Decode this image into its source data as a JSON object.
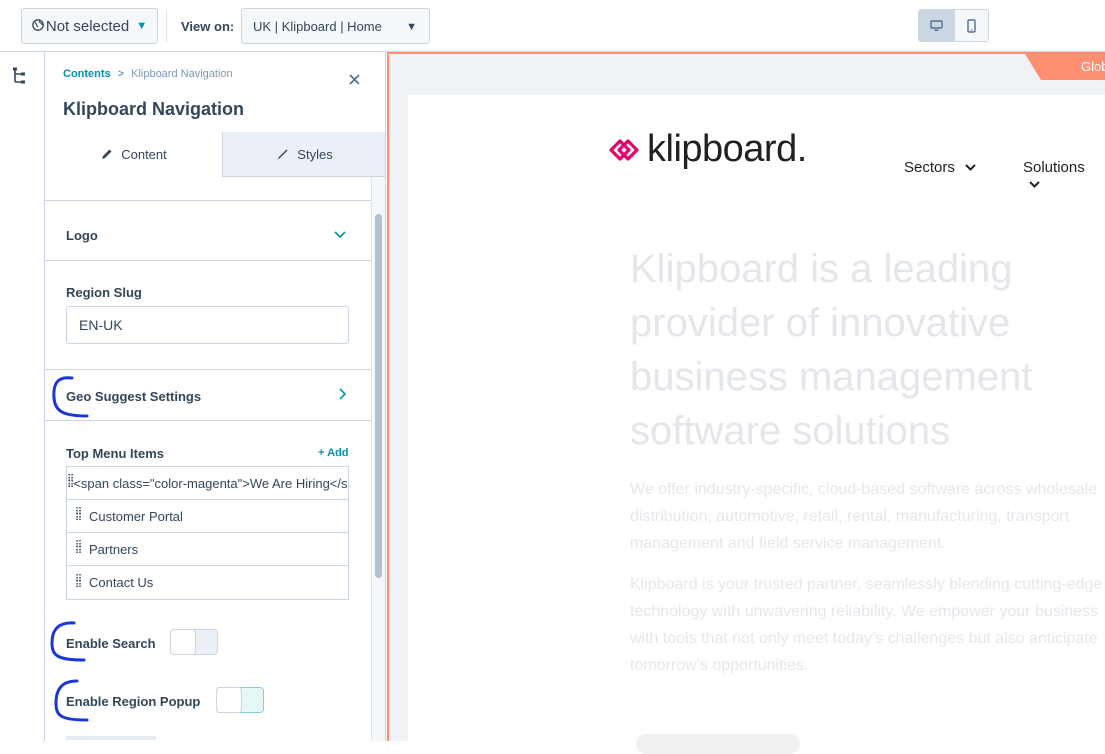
{
  "topbar": {
    "language_label": "Not selected",
    "view_on_label": "View on:",
    "view_on_value": "UK | Klipboard | Home"
  },
  "panel": {
    "breadcrumb_root": "Contents",
    "breadcrumb_separator": ">",
    "breadcrumb_current": "Klipboard Navigation",
    "title": "Klipboard Navigation",
    "tabs": [
      {
        "label": "Content",
        "active": true
      },
      {
        "label": "Styles",
        "active": false
      }
    ],
    "logo_label": "Logo",
    "region_slug_label": "Region Slug",
    "region_slug_value": "EN-UK",
    "geo_suggest_label": "Geo Suggest Settings",
    "top_menu_label": "Top Menu Items",
    "add_label": "+ Add",
    "menu_items": [
      "<span class=\"color-magenta\">We Are Hiring</span>",
      "Customer Portal",
      "Partners",
      "Contact Us"
    ],
    "enable_search_label": "Enable Search",
    "enable_search_on": false,
    "enable_region_popup_label": "Enable Region Popup",
    "enable_region_popup_on": true
  },
  "preview": {
    "global_badge": "Glob",
    "logo_text": "klipboard.",
    "nav_items": [
      "Sectors",
      "Solutions"
    ],
    "hero_heading": "Klipboard is a leading provider of innovative business management software solutions",
    "paragraph_1": "We offer industry-specific, cloud-based software across wholesale distribution, automotive, retail, rental, manufacturing, transport management and field service management.",
    "paragraph_2": "Klipboard is your trusted partner, seamlessly blending cutting-edge technology with unwavering reliability. We empower your business with tools that not only meet today’s challenges but also anticipate tomorrow’s opportunities.",
    "brand_color": "#e5006d",
    "accent_color": "#ff8f73"
  }
}
